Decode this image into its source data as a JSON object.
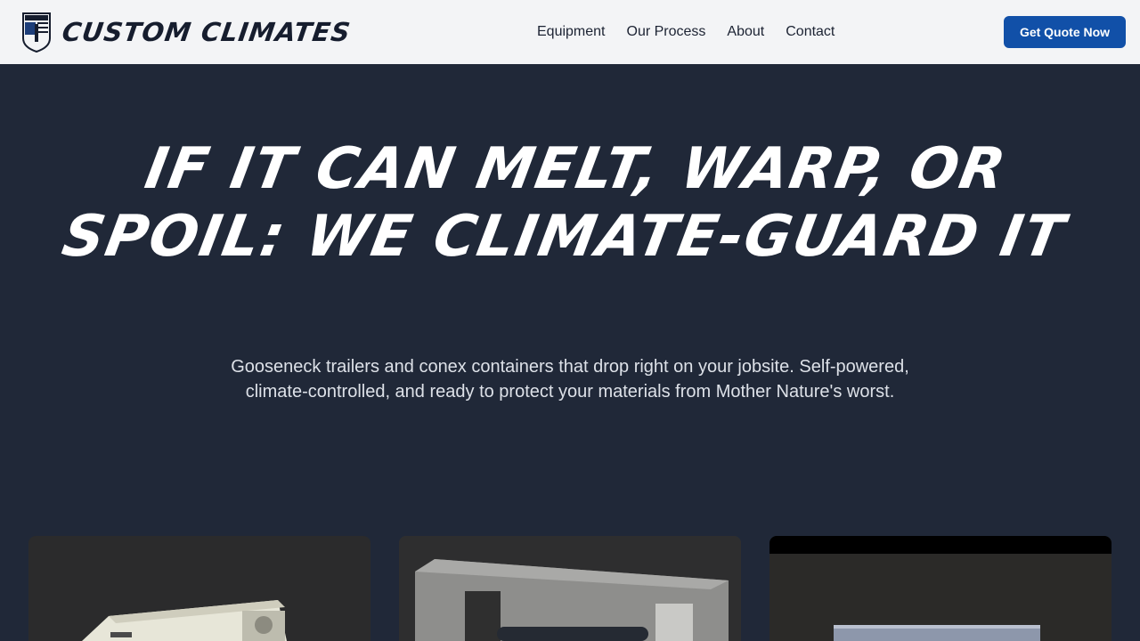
{
  "header": {
    "brand": "CUSTOM CLIMATES",
    "logo_icon": "shield-logo-icon",
    "nav": [
      "Equipment",
      "Our Process",
      "About",
      "Contact"
    ],
    "cta_label": "Get Quote Now"
  },
  "hero": {
    "title": "IF IT CAN MELT, WARP, OR SPOIL: WE CLIMATE-GUARD IT",
    "subtitle": "Gooseneck trailers and conex containers that drop right on your jobsite. Self-powered, climate-controlled, and ready to protect your materials from Mother Nature's worst."
  },
  "cards": [
    {
      "image": "trailer-photo"
    },
    {
      "image": "conex-container-photo"
    },
    {
      "image": "container-photo"
    }
  ],
  "colors": {
    "nav_bg": "#f3f4f6",
    "page_bg": "#202838",
    "cta": "#1150a8"
  }
}
